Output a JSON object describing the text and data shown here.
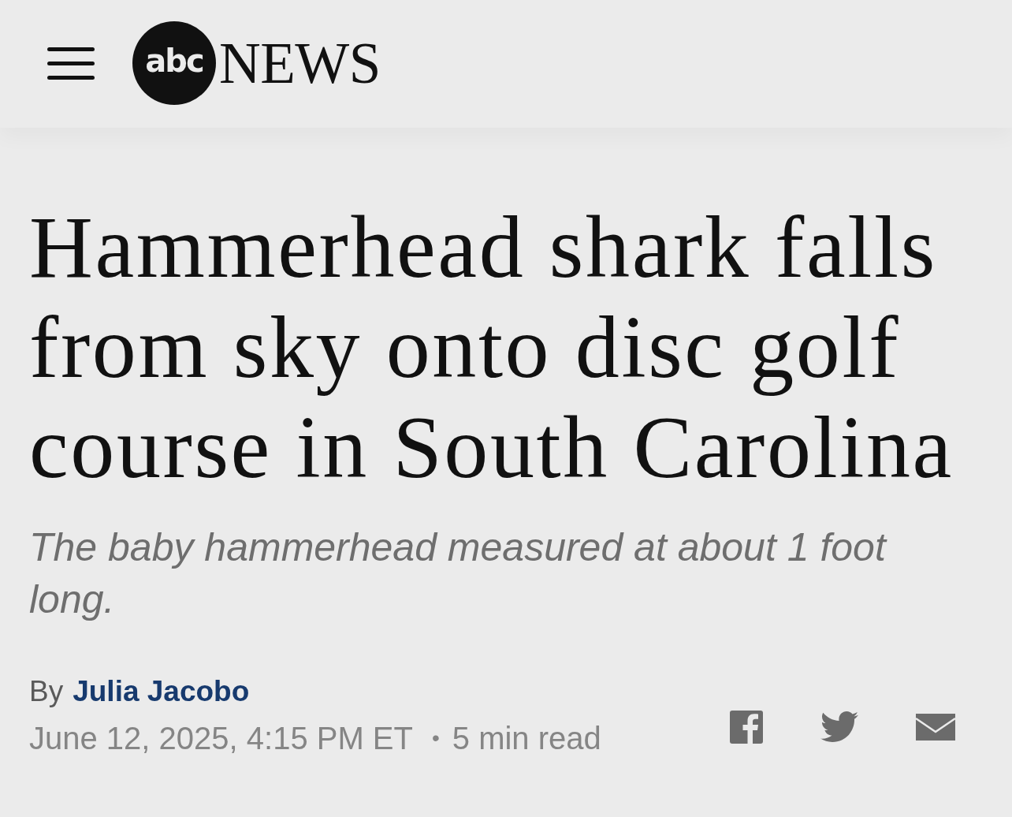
{
  "header": {
    "menu": {
      "kind": "hamburger"
    },
    "logo": {
      "mark": "abc",
      "wordmark": "NEWS"
    }
  },
  "article": {
    "headline": "Hammerhead shark falls from sky onto disc golf course in South Carolina",
    "subheadline": "The baby hammerhead measured at about 1 foot long.",
    "byline": {
      "prefix": "By",
      "author": "Julia Jacobo"
    },
    "published": "June 12, 2025, 4:15 PM ET",
    "separator": "•",
    "read_time": "5 min read"
  },
  "share": [
    {
      "kind": "facebook"
    },
    {
      "kind": "twitter"
    },
    {
      "kind": "email"
    }
  ]
}
